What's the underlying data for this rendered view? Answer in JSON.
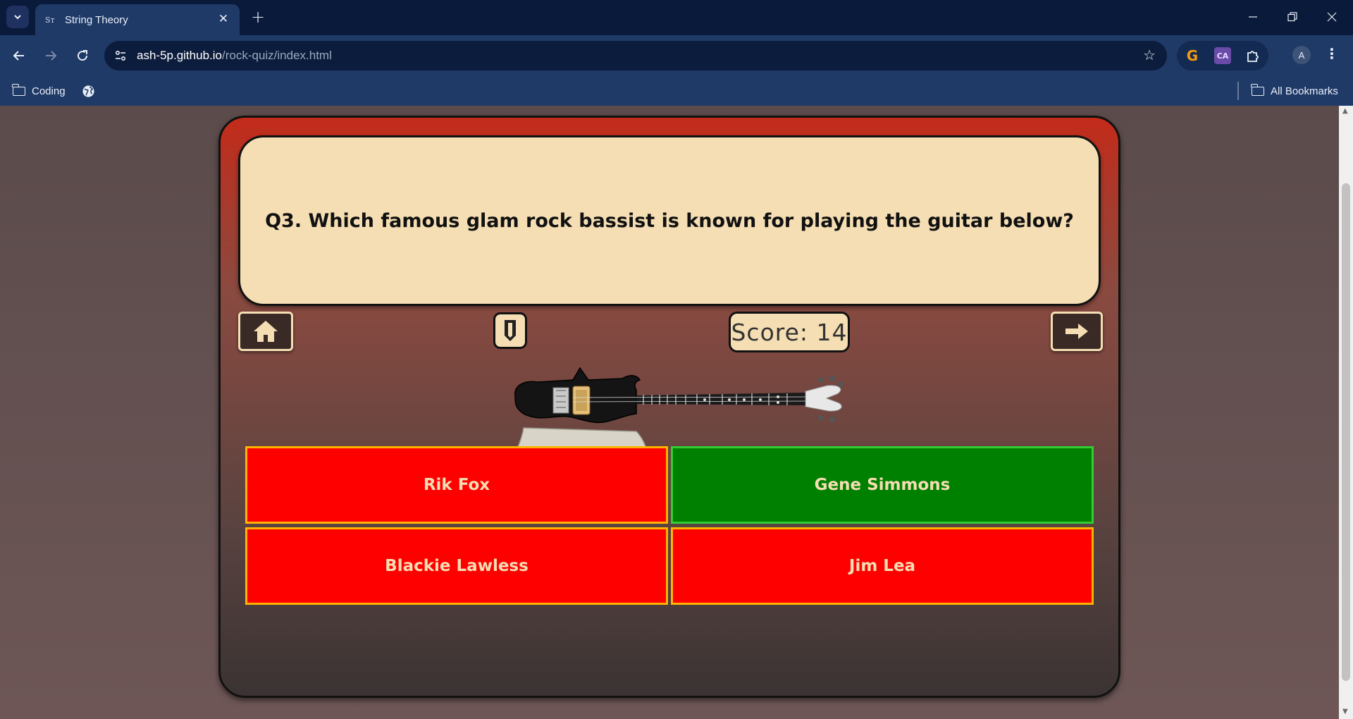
{
  "browser": {
    "tab_title": "String Theory",
    "tab_favicon": "Sᴛ",
    "url_host": "ash-5p.github.io",
    "url_path": "/rock-quiz/index.html",
    "profile_initial": "A",
    "bookmarks": [
      {
        "label": "Coding",
        "icon": "folder-icon"
      },
      {
        "label": "",
        "icon": "globe-icon"
      }
    ],
    "all_bookmarks_label": "All Bookmarks",
    "extensions": [
      "g-extension-icon",
      "ca-extension-icon",
      "puzzle-icon"
    ]
  },
  "quiz": {
    "question": "Q3. Which famous glam rock bassist is known for playing the guitar below?",
    "score_label": "Score: 14",
    "pick_icon": "guitar-pick-icon",
    "home_icon": "home-icon",
    "next_icon": "arrow-right-icon",
    "image_subject": "axe-bass-guitar",
    "answers": [
      {
        "label": "Rik Fox",
        "status": "wrong",
        "color": "#ff0000"
      },
      {
        "label": "Gene Simmons",
        "status": "correct",
        "color": "#008000"
      },
      {
        "label": "Blackie Lawless",
        "status": "wrong",
        "color": "#ff0000"
      },
      {
        "label": "Jim Lea",
        "status": "wrong",
        "color": "#ff0000"
      }
    ]
  },
  "colors": {
    "chrome_dark": "#0a1a3a",
    "chrome": "#1f3a67",
    "card_cream": "#f5deb3",
    "answer_wrong": "#ff0000",
    "answer_correct": "#008000",
    "answer_border": "#ffb300"
  }
}
